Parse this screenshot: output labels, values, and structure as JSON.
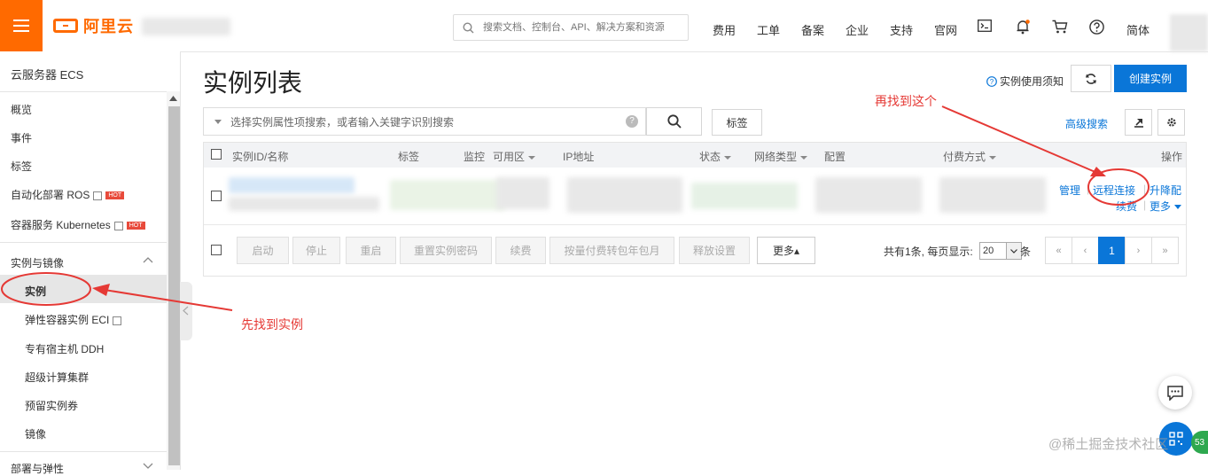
{
  "topbar": {
    "brand": "阿里云",
    "search_placeholder": "搜索文档、控制台、API、解决方案和资源",
    "nav": [
      "费用",
      "工单",
      "备案",
      "企业",
      "支持",
      "官网"
    ],
    "lang": "简体"
  },
  "sidebar": {
    "title": "云服务器 ECS",
    "items": [
      "概览",
      "事件",
      "标签",
      "自动化部署 ROS",
      "容器服务 Kubernetes"
    ],
    "hot": "HOT",
    "group": "实例与镜像",
    "sub_items": [
      "实例",
      "弹性容器实例 ECI",
      "专有宿主机 DDH",
      "超级计算集群",
      "预留实例券",
      "镜像"
    ],
    "next_group": "部署与弹性"
  },
  "main": {
    "title": "实例列表",
    "notice": "实例使用须知",
    "create_button": "创建实例",
    "filter_placeholder": "选择实例属性项搜索，或者输入关键字识别搜索",
    "tag_button": "标签",
    "advanced_search": "高级搜索",
    "columns": [
      "实例ID/名称",
      "标签",
      "监控",
      "可用区",
      "IP地址",
      "状态",
      "网络类型",
      "配置",
      "付费方式",
      "操作"
    ],
    "row_actions": [
      "管理",
      "远程连接",
      "升降配",
      "续费",
      "更多"
    ],
    "footer_buttons": [
      "启动",
      "停止",
      "重启",
      "重置实例密码",
      "续费",
      "按量付费转包年包月",
      "释放设置",
      "更多▴"
    ],
    "total": "共有1条, 每页显示:",
    "page_size": "20",
    "page_size_unit": "条",
    "pagination": [
      "«",
      "‹",
      "1",
      "›",
      "»"
    ]
  },
  "annotations": {
    "step1": "先找到实例",
    "step2": "再找到这个"
  },
  "floating": {
    "badge": "53"
  },
  "watermark": "@稀土掘金技术社区",
  "colors": {
    "brand": "#ff6a00",
    "primary": "#0a76d8",
    "annotation": "#e53935"
  }
}
